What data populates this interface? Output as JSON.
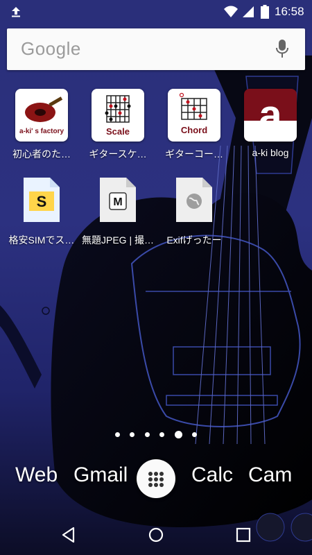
{
  "status_bar": {
    "time": "16:58",
    "icons": [
      "upload-icon",
      "wifi-icon",
      "signal-icon",
      "battery-icon"
    ]
  },
  "search": {
    "logo": "Google",
    "icon": "mic-icon"
  },
  "apps_row1": [
    {
      "label": "初心者のた…",
      "icon_caption": "a-ki' s factory"
    },
    {
      "label": "ギタースケ…",
      "icon_caption": "Scale"
    },
    {
      "label": "ギターコー…",
      "icon_caption": "Chord"
    },
    {
      "label": "a-ki blog",
      "icon_caption": "a"
    }
  ],
  "apps_row2": [
    {
      "label": "格安SIMでス…",
      "icon_caption": "S"
    },
    {
      "label": "無題JPEG | 撮…",
      "icon_caption": "M"
    },
    {
      "label": "Exifげったー",
      "icon_caption": ""
    }
  ],
  "pager": {
    "count": 6,
    "active_index": 4
  },
  "dock": {
    "left1": "Web",
    "left2": "Gmail",
    "right1": "Calc",
    "right2": "Cam"
  },
  "nav": [
    "back-icon",
    "home-icon",
    "recents-icon"
  ],
  "colors": {
    "wallpaper_blue": "#2a2f7a",
    "brand_red": "#7a0f1a",
    "accent_yellow": "#ffd54a"
  }
}
